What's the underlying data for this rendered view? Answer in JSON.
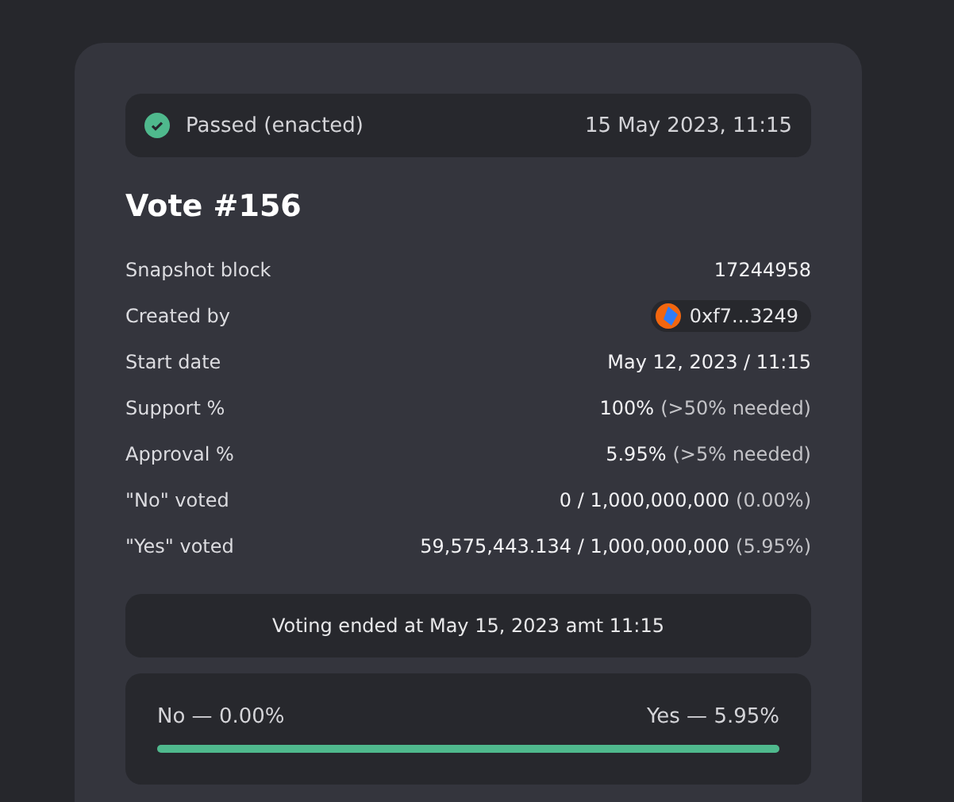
{
  "status": {
    "label": "Passed (enacted)",
    "passed": true,
    "date": "15 May 2023, 11:15"
  },
  "title": "Vote #156",
  "details": [
    {
      "kind": "text",
      "label": "Snapshot block",
      "value": "17244958"
    },
    {
      "kind": "address",
      "label": "Created by",
      "value": "0xf7...3249"
    },
    {
      "kind": "text",
      "label": "Start date",
      "value": "May 12, 2023 / 11:15"
    },
    {
      "kind": "text",
      "label": "Support %",
      "value": "100%",
      "note": "(>50% needed)"
    },
    {
      "kind": "text",
      "label": "Approval %",
      "value": "5.95%",
      "note": "(>5% needed)"
    },
    {
      "kind": "text",
      "label": "\"No\" voted",
      "value": "0  / 1,000,000,000",
      "note": "(0.00%)"
    },
    {
      "kind": "text",
      "label": "\"Yes\" voted",
      "value": "59,575,443.134  / 1,000,000,000",
      "note": "(5.95%)"
    }
  ],
  "ended": "Voting ended at May 15, 2023 amt 11:15",
  "result": {
    "no": "No — 0.00%",
    "yes": "Yes — 5.95%",
    "level": 1
  }
}
